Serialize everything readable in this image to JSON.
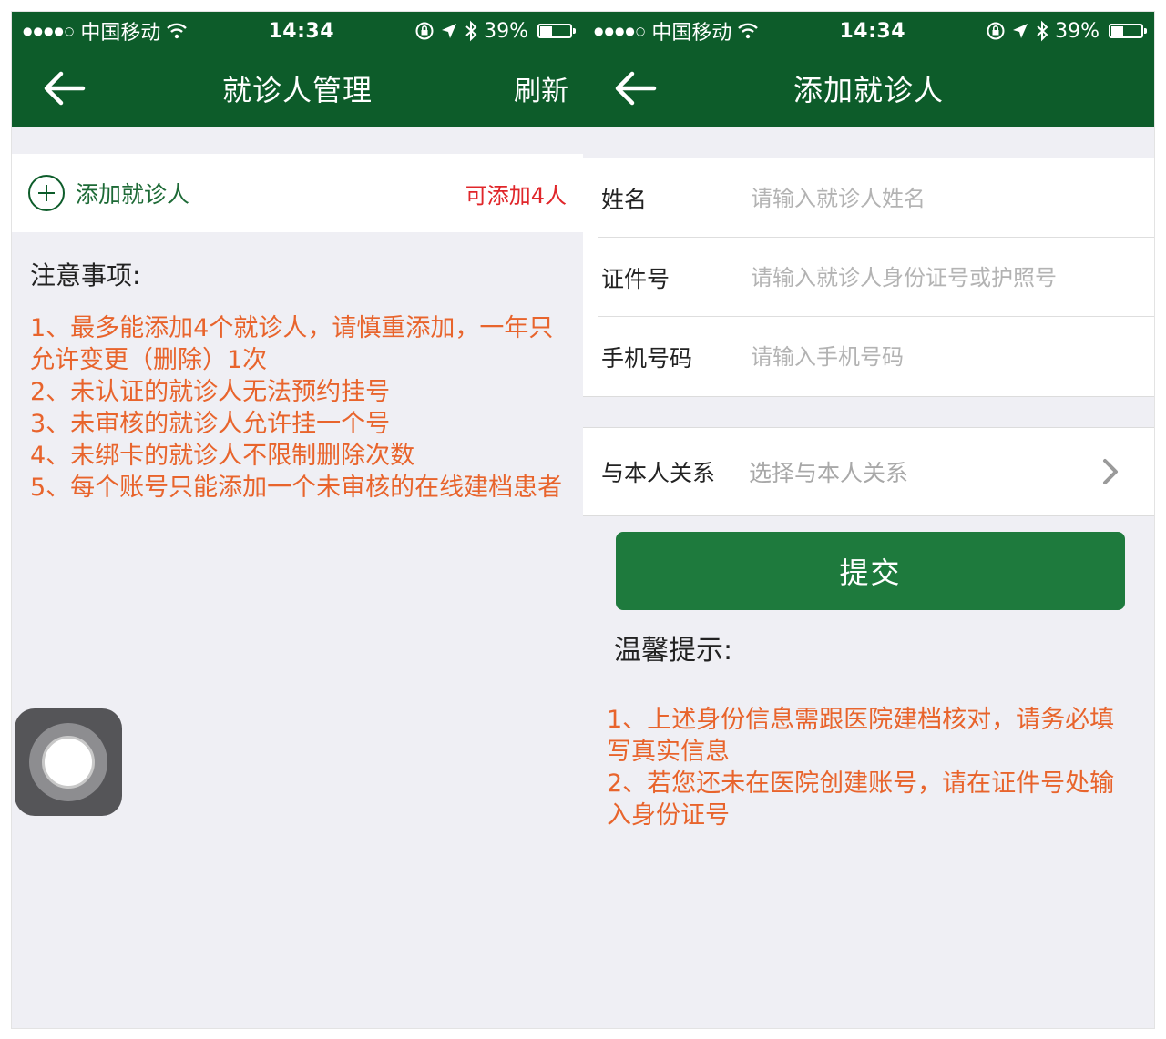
{
  "status_bar": {
    "carrier": "中国移动",
    "time": "14:34",
    "battery": "39%",
    "battery_level": 0.39
  },
  "left_screen": {
    "nav": {
      "title": "就诊人管理",
      "action": "刷新"
    },
    "add_patient": {
      "label": "添加就诊人",
      "count": "可添加4人"
    },
    "notes": {
      "title": "注意事项:",
      "items": [
        "1、最多能添加4个就诊人，请慎重添加，一年只允许变更（删除）1次",
        "2、未认证的就诊人无法预约挂号",
        "3、未审核的就诊人允许挂一个号",
        "4、未绑卡的就诊人不限制删除次数",
        "5、每个账号只能添加一个未审核的在线建档患者"
      ]
    }
  },
  "right_screen": {
    "nav": {
      "title": "添加就诊人"
    },
    "form": {
      "name": {
        "label": "姓名",
        "placeholder": "请输入就诊人姓名",
        "value": ""
      },
      "id_number": {
        "label": "证件号",
        "placeholder": "请输入就诊人身份证号或护照号",
        "value": ""
      },
      "phone": {
        "label": "手机号码",
        "placeholder": "请输入手机号码",
        "value": ""
      },
      "relation": {
        "label": "与本人关系",
        "value": "选择与本人关系"
      }
    },
    "submit_label": "提交",
    "tips": {
      "title": "温馨提示:",
      "items": [
        "1、上述身份信息需跟医院建档核对，请务必填写真实信息",
        "2、若您还未在医院创建账号，请在证件号处输入身份证号"
      ]
    }
  },
  "colors": {
    "header_green": "#0d5c2a",
    "button_green": "#1e7a3d",
    "note_orange": "#e8642c",
    "count_red": "#e0262a"
  },
  "icons": [
    "signal-dots-icon",
    "wifi-icon",
    "rotation-lock-icon",
    "location-arrow-icon",
    "bluetooth-icon",
    "battery-icon",
    "back-arrow-icon",
    "add-circle-icon",
    "chevron-right-icon",
    "assistive-touch-icon"
  ]
}
